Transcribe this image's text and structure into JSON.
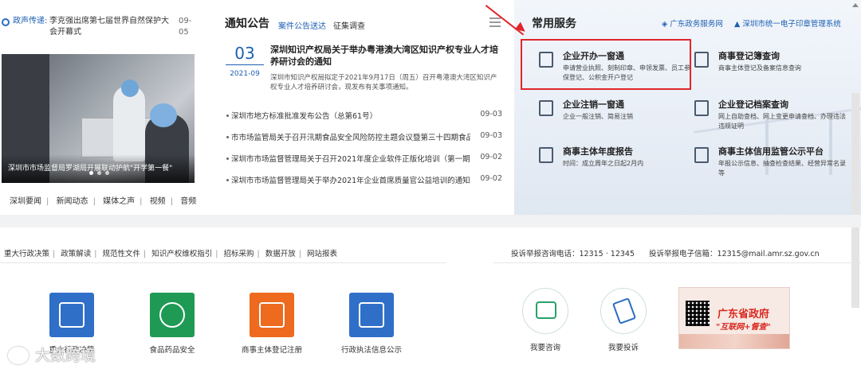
{
  "ticker": {
    "label": "政声传递:",
    "text": "李克强出席第七届世界自然保护大会开幕式",
    "date": "09-05"
  },
  "photo": {
    "caption": "深圳市市场监督局罗湖局开展联动护航\"开学第一餐\""
  },
  "left_links": [
    "深圳要闻",
    "新闻动态",
    "媒体之声",
    "视频",
    "音频"
  ],
  "notice": {
    "title": "通知公告",
    "tabs": [
      "案件公告送达",
      "征集调查"
    ],
    "featured": {
      "day": "03",
      "month": "2021-09",
      "title": "深圳知识产权局关于举办粤港澳大湾区知识产权专业人才培养研讨会的通知",
      "summary": "深圳市知识产权局拟定于2021年9月17日（周五）召开粤港澳大湾区知识产权专业人才培养研讨会，现发布有关事项通知。"
    },
    "items": [
      {
        "title": "深圳市地方标准批准发布公告（总第61号）",
        "date": "09-03"
      },
      {
        "title": "市市场监管局关于召开汛期食品安全风险防控主题会议暨第三十四期食品安全",
        "date": "09-03"
      },
      {
        "title": "深圳市市场监督管理局关于召开2021年度企业软件正版化培训（第一期）的通知",
        "date": "09-02"
      },
      {
        "title": "深圳市市场监督管理局关于举办2021年企业首席质量官公益培训的通知",
        "date": "09-02"
      }
    ]
  },
  "services": {
    "title": "常用服务",
    "links": [
      "广东政务服务网",
      "深圳市统一电子印章管理系统"
    ],
    "items": [
      {
        "name": "企业开办一窗通",
        "desc": "申请营业执照、刻制印章、申领发票、员工参保登记、公积金开户登记",
        "icon": "building-doc-icon"
      },
      {
        "name": "商事登记簿查询",
        "desc": "商事主体登记及备案信息查询",
        "icon": "search-doc-icon"
      },
      {
        "name": "企业注销一窗通",
        "desc": "企业一般注销、简易注销",
        "icon": "power-doc-icon"
      },
      {
        "name": "企业登记档案查询",
        "desc": "网上自助查档、网上变更申请查档、办理违法违规证明",
        "icon": "archive-icon"
      },
      {
        "name": "商事主体年度报告",
        "desc": "时间：成立周年之日起2月内",
        "icon": "report-icon"
      },
      {
        "name": "商事主体信用监管公示平台",
        "desc": "年报公示信息、抽查检查结果、经营异常名录等",
        "icon": "shield-house-icon"
      }
    ]
  },
  "mid_links": [
    "重大行政决策",
    "政策解读",
    "规范性文件",
    "知识产权维权指引",
    "招标采购",
    "数据开放",
    "网站报表"
  ],
  "hotline": "投诉举报咨询电话：12315 · 12345",
  "email": "投诉举报电子信箱：12315@mail.amr.sz.gov.cn",
  "tiles": [
    {
      "label": "重大行政决策",
      "color": "#2f6fc8",
      "icon": "people-icon"
    },
    {
      "label": "食品药品安全",
      "color": "#1e9a55",
      "icon": "fda-icon"
    },
    {
      "label": "商事主体登记注册",
      "color": "#ee6a1e",
      "icon": "card-icon"
    },
    {
      "label": "行政执法信息公示",
      "color": "#2f6fc8",
      "icon": "badge-icon"
    }
  ],
  "circles": [
    {
      "label": "我要咨询",
      "icon": "chat-icon"
    },
    {
      "label": "我要投诉",
      "icon": "pen-icon"
    }
  ],
  "banner": {
    "line1": "广东省政府",
    "line2": "\"互联网+督查\""
  },
  "watermark": "大数跨境"
}
